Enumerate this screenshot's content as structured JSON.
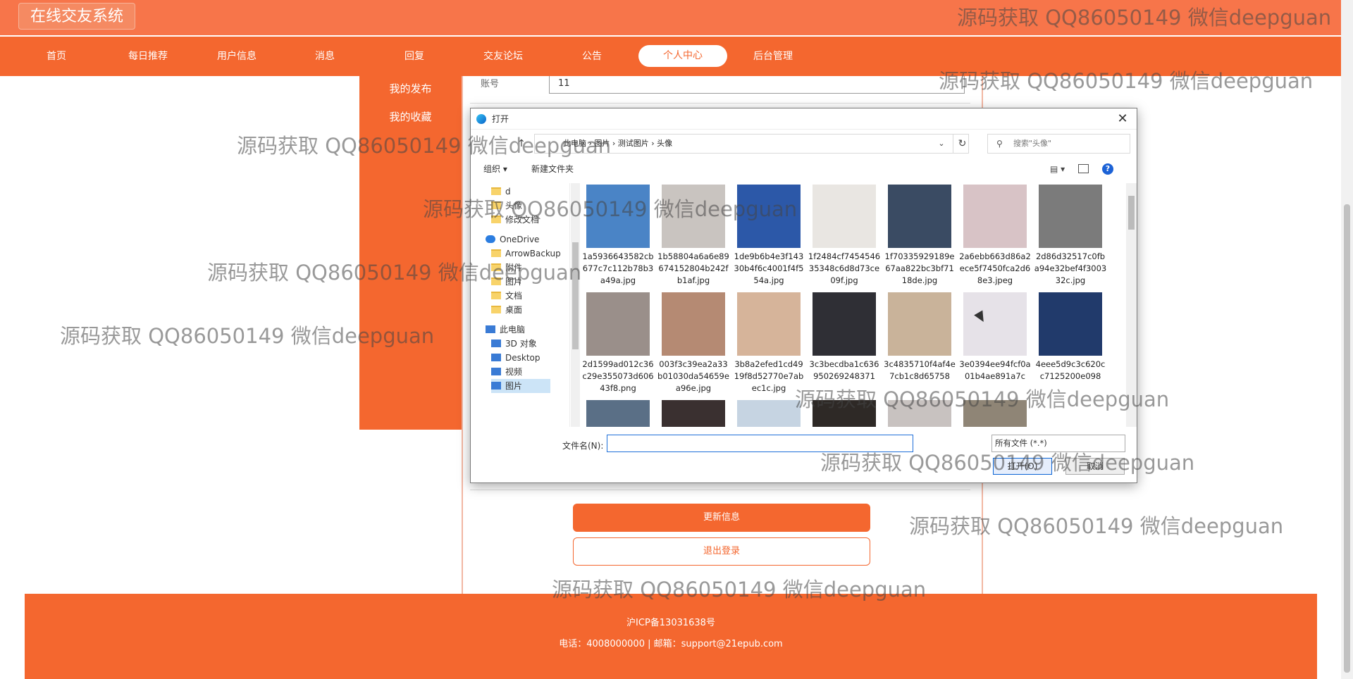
{
  "header": {
    "brand": "在线交友系统"
  },
  "nav": {
    "items": [
      "首页",
      "每日推荐",
      "用户信息",
      "消息",
      "回复",
      "交友论坛",
      "公告",
      "个人中心",
      "后台管理"
    ],
    "active_index": 7
  },
  "sidebar": {
    "items": [
      "我的发布",
      "我的收藏"
    ]
  },
  "form": {
    "account_label": "账号",
    "account_value": "11"
  },
  "buttons": {
    "update": "更新信息",
    "logout": "退出登录"
  },
  "footer": {
    "icp": "沪ICP备13031638号",
    "contact": "电话：4008000000 | 邮箱：support@21epub.com"
  },
  "dialog": {
    "title": "打开",
    "breadcrumb": "此电脑  ›  图片  ›  测试图片  ›  头像",
    "search_placeholder": "搜索\"头像\"",
    "toolbar": {
      "organize": "组织 ▾",
      "new_folder": "新建文件夹"
    },
    "tree": [
      {
        "label": "d",
        "type": "folder"
      },
      {
        "label": "头像",
        "type": "folder"
      },
      {
        "label": "修改文档",
        "type": "folder"
      },
      {
        "label": "OneDrive",
        "type": "cloud"
      },
      {
        "label": "ArrowBackup",
        "type": "folder"
      },
      {
        "label": "附件",
        "type": "folder"
      },
      {
        "label": "图片",
        "type": "folder"
      },
      {
        "label": "文档",
        "type": "folder"
      },
      {
        "label": "桌面",
        "type": "folder"
      },
      {
        "label": "此电脑",
        "type": "pc"
      },
      {
        "label": "3D 对象",
        "type": "pc"
      },
      {
        "label": "Desktop",
        "type": "pc"
      },
      {
        "label": "视频",
        "type": "pc"
      },
      {
        "label": "图片",
        "type": "pc"
      }
    ],
    "files": [
      {
        "name": "1a5936643582cb677c7c112b78b3a49a.jpg",
        "color": "#4a84c6"
      },
      {
        "name": "1b58804a6a6e89674152804b242fb1af.jpg",
        "color": "#c9c4c0"
      },
      {
        "name": "1de9b6b4e3f14330b4f6c4001f4f554a.jpg",
        "color": "#2c58a8"
      },
      {
        "name": "1f2484cf745454635348c6d8d73ce09f.jpg",
        "color": "#e9e6e2"
      },
      {
        "name": "1f70335929189e67aa822bc3bf7118de.jpg",
        "color": "#3a4b63"
      },
      {
        "name": "2a6ebb663d86a2ece5f7450fca2d68e3.jpeg",
        "color": "#d8c3c6"
      },
      {
        "name": "2d86d32517c0fba94e32bef4f300332c.jpg",
        "color": "#7b7b7b"
      },
      {
        "name": "2d1599ad012c36c29e355073d60643f8.png",
        "color": "#9a8f8a"
      },
      {
        "name": "003f3c39ea2a33b01030da54659ea96e.jpg",
        "color": "#b58a73"
      },
      {
        "name": "3b8a2efed1cd4919f8d52770e7abec1c.jpg",
        "color": "#d6b49a"
      },
      {
        "name": "3c3becdba1c636950269248371",
        "color": "#2f2f35"
      },
      {
        "name": "3c4835710f4af4e7cb1c8d65758",
        "color": "#c9b39a"
      },
      {
        "name": "3e0394ee94fcf0a01b4ae891a7c",
        "color": "#e6e2e8"
      },
      {
        "name": "4eee5d9c3c620cc7125200e098",
        "color": "#213a6b"
      },
      {
        "name": "",
        "color": "#5a6f86"
      },
      {
        "name": "",
        "color": "#3a3030"
      },
      {
        "name": "",
        "color": "#c6d4e2"
      },
      {
        "name": "",
        "color": "#2e2926"
      },
      {
        "name": "",
        "color": "#c8c2c0"
      },
      {
        "name": "",
        "color": "#8f8576"
      }
    ],
    "filename_label": "文件名(N):",
    "filetype": "所有文件 (*.*)",
    "open_button": "打开(O)",
    "cancel_button": "取消"
  },
  "watermark": "源码获取 QQ86050149 微信deepguan",
  "colors": {
    "primary": "#f4672f",
    "topbar": "#f7754a"
  }
}
